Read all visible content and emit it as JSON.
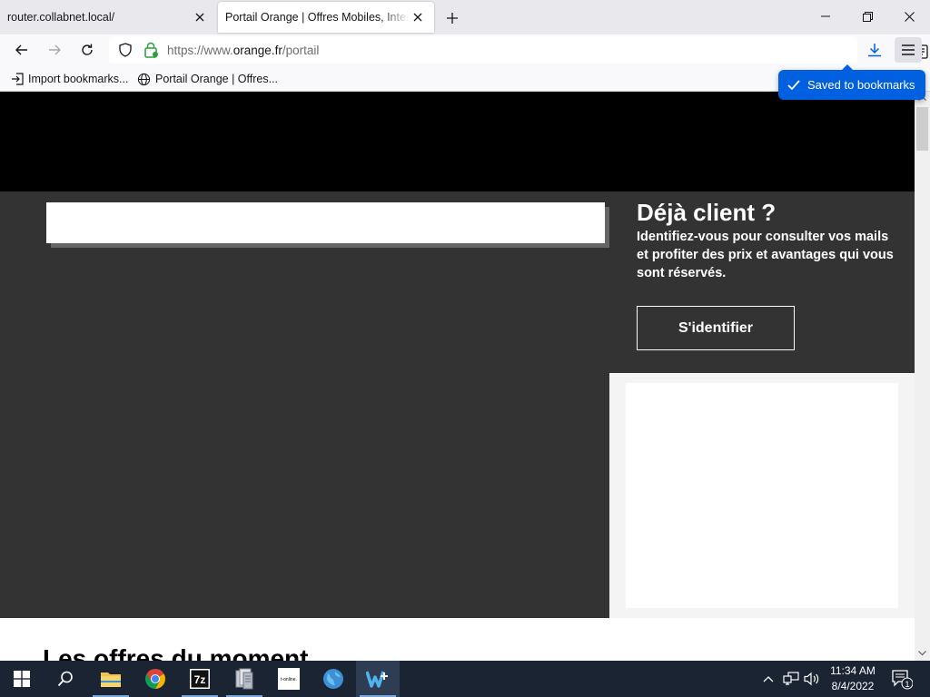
{
  "tabs": [
    {
      "title": "router.collabnet.local/"
    },
    {
      "title": "Portail Orange | Offres Mobiles, Interne"
    }
  ],
  "address": {
    "scheme": "https://www.",
    "domain": "orange.fr",
    "path": "/portail"
  },
  "bookmarks": [
    {
      "label": "Import bookmarks..."
    },
    {
      "label": "Portail Orange | Offres..."
    }
  ],
  "toast": {
    "label": "Saved to bookmarks"
  },
  "page": {
    "login_title": "Déjà client ?",
    "login_text": "Identifiez-vous pour consulter vos mails et profiter des prix et avantages qui vous sont réservés.",
    "login_button": "S'identifier",
    "offers_heading": "Les offres du moment"
  },
  "taskbar": {
    "apps": [
      "start",
      "search",
      "file-explorer",
      "chrome",
      "7-zip",
      "archive",
      "t-online",
      "globe-browser",
      "active-app"
    ],
    "tonline_label": "t-online.",
    "sevenzip_label": "7z"
  },
  "clock": {
    "time": "11:34 AM",
    "date": "8/4/2022"
  },
  "notifications": {
    "count": "1"
  },
  "colors": {
    "accent": "#0060df",
    "dark_panel": "#333333",
    "taskbar": "#1a2433"
  }
}
